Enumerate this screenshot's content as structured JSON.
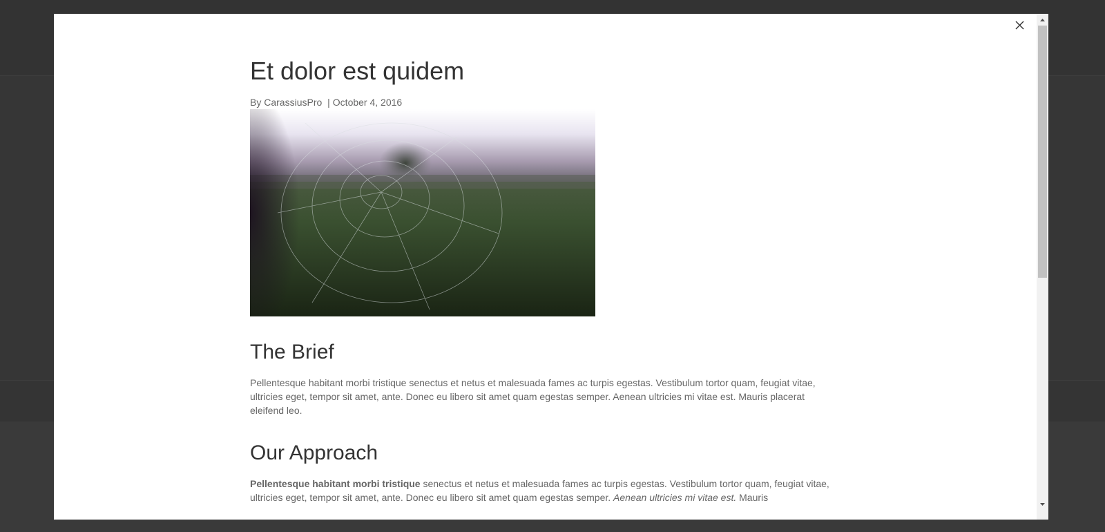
{
  "post": {
    "title": "Et dolor est quidem",
    "author_prefix": "By",
    "author": "CarassiusPro",
    "separator": "|",
    "date": "October 4, 2016"
  },
  "sections": {
    "brief": {
      "title": "The Brief",
      "text": "Pellentesque habitant morbi tristique senectus et netus et malesuada fames ac turpis egestas. Vestibulum tortor quam, feugiat vitae, ultricies eget, tempor sit amet, ante. Donec eu libero sit amet quam egestas semper. Aenean ultricies mi vitae est. Mauris placerat eleifend leo."
    },
    "approach": {
      "title": "Our Approach",
      "bold_lead": "Pellentesque habitant morbi tristique",
      "text_mid": " senectus et netus et malesuada fames ac turpis egestas. Vestibulum tortor quam, feugiat vitae, ultricies eget, tempor sit amet, ante. Donec eu libero sit amet quam egestas semper. ",
      "italic": "Aenean ultricies mi vitae est.",
      "text_end": " Mauris"
    }
  },
  "icons": {
    "close": "close-icon",
    "scroll_up": "scroll-up-arrow-icon",
    "scroll_down": "scroll-down-arrow-icon"
  },
  "colors": {
    "overlay": "#333333",
    "modal_bg": "#ffffff",
    "heading": "#333333",
    "body_text": "#666666"
  }
}
